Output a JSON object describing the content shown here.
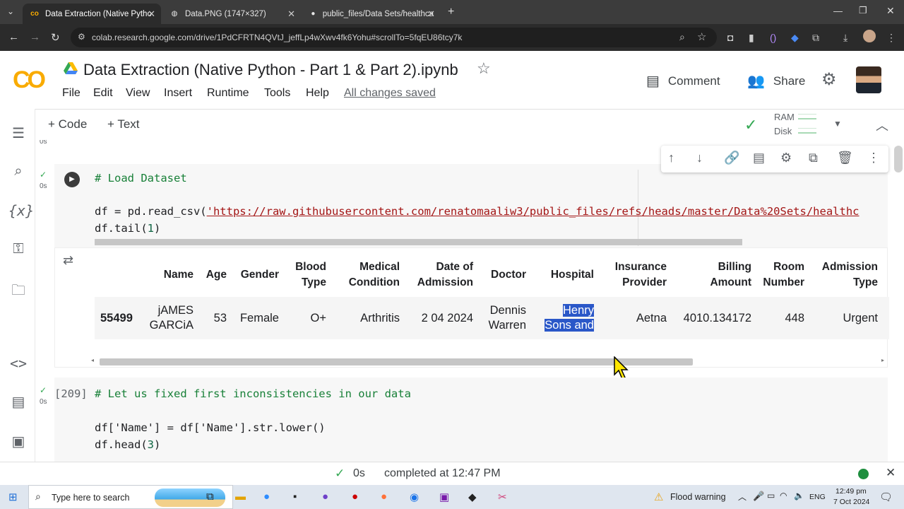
{
  "browser": {
    "tabs": [
      {
        "label": "Data Extraction (Native Pytho",
        "active": true
      },
      {
        "label": "Data.PNG (1747×327)",
        "active": false
      },
      {
        "label": "public_files/Data Sets/healthca",
        "active": false
      }
    ],
    "url": "colab.research.google.com/drive/1PdCFRTN4QVtJ_jeffLp4wXwv4fk6Yohu#scrollTo=5fqEU86tcy7k"
  },
  "header": {
    "logo": "CO",
    "title": "Data Extraction (Native Python - Part 1 & Part 2).ipynb",
    "menu": [
      "File",
      "Edit",
      "View",
      "Insert",
      "Runtime",
      "Tools",
      "Help"
    ],
    "save_status": "All changes saved",
    "comment_label": "Comment",
    "share_label": "Share"
  },
  "toolbar": {
    "add_code": "+ Code",
    "add_text": "+ Text",
    "ram_label": "RAM",
    "disk_label": "Disk"
  },
  "cells": {
    "prev_exec_time": "0s",
    "load": {
      "exec_time": "0s",
      "line1": "# Load Dataset",
      "line2_prefix": "df = pd.read_csv(",
      "line2_str": "'https://raw.githubusercontent.com/renatomaaliw3/public_files/refs/heads/master/Data%20Sets/healthc",
      "line3_prefix": "df.tail(",
      "line3_num": "1",
      "line3_suffix": ")"
    },
    "output": {
      "headers": [
        "Name",
        "Age",
        "Gender",
        "Blood Type",
        "Medical Condition",
        "Date of Admission",
        "Doctor",
        "Hospital",
        "Insurance Provider",
        "Billing Amount",
        "Room Number",
        "Admission Type"
      ],
      "row": {
        "index": "55499",
        "name_l1": "jAMES",
        "name_l2": "GARCiA",
        "age": "53",
        "gender": "Female",
        "blood": "O+",
        "condition": "Arthritis",
        "date": "2 04 2024",
        "doctor_l1": "Dennis",
        "doctor_l2": "Warren",
        "hospital_l1": "Henry",
        "hospital_l2": "Sons and",
        "insurance": "Aetna",
        "billing": "4010.134172",
        "room": "448",
        "admission": "Urgent"
      }
    },
    "fix": {
      "exec_count": "[209]",
      "exec_time": "0s",
      "line1": "# Let us fixed first inconsistencies in our data",
      "line2": "df['Name'] = df['Name'].str.lower()",
      "line3_prefix": "df.head(",
      "line3_num": "3",
      "line3_suffix": ")"
    }
  },
  "statusbar": {
    "time": "0s",
    "completed": "completed at 12:47 PM"
  },
  "taskbar": {
    "search_placeholder": "Type here to search",
    "weather": "Flood warning",
    "lang": "ENG",
    "clock": "12:49 pm",
    "date": "7 Oct 2024"
  },
  "colors": {
    "accent_orange": "#f9ab00",
    "run_green": "#34a853",
    "selection_blue": "#2a57c8",
    "comment_green": "#188038"
  }
}
